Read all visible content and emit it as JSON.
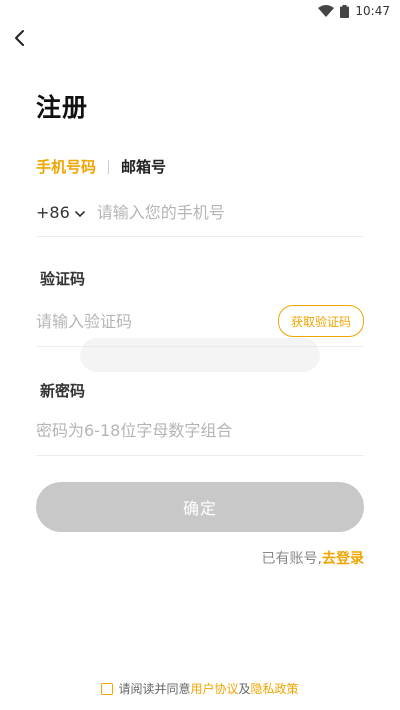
{
  "status_bar": {
    "time": "10:47"
  },
  "header": {
    "title": "注册"
  },
  "tabs": [
    {
      "label": "手机号码",
      "active": true
    },
    {
      "label": "邮箱号",
      "active": false
    }
  ],
  "phone": {
    "country_code": "+86",
    "placeholder": "请输入您的手机号",
    "value": ""
  },
  "code": {
    "label": "验证码",
    "placeholder": "请输入验证码",
    "value": "",
    "get_code_label": "获取验证码"
  },
  "password": {
    "label": "新密码",
    "placeholder": "密码为6-18位字母数字组合",
    "value": ""
  },
  "submit": {
    "label": "确定"
  },
  "login_hint": {
    "prefix": "已有账号,",
    "link": "去登录"
  },
  "agreement": {
    "prefix": "请阅读并同意",
    "user_agreement": "用户协议",
    "and": "及",
    "privacy_policy": "隐私政策",
    "checked": false
  },
  "colors": {
    "accent": "#f0a500",
    "button_disabled": "#c8c8c8",
    "placeholder": "#b5b5b5",
    "divider": "#ececec"
  }
}
